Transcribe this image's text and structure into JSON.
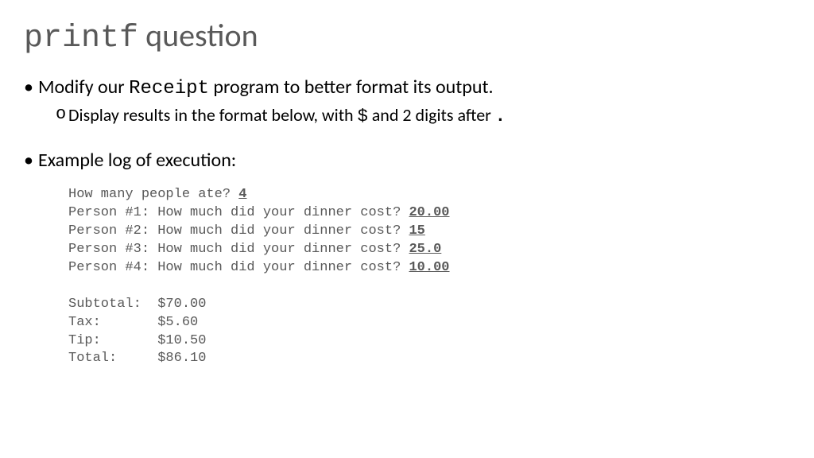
{
  "title": {
    "code": "printf",
    "rest": " question"
  },
  "bullet1": {
    "pre": "Modify our ",
    "code": "Receipt",
    "post": " program to better format its output."
  },
  "sub1": {
    "pre": "Display results in the format below, with ",
    "code1": "$",
    "mid": " and 2 digits after ",
    "code2": "."
  },
  "bullet2": "Example log of execution:",
  "log": {
    "q0": "How many people ate? ",
    "a0": "4",
    "q1": "Person #1: How much did your dinner cost? ",
    "a1": "20.00",
    "q2": "Person #2: How much did your dinner cost? ",
    "a2": "15",
    "q3": "Person #3: How much did your dinner cost? ",
    "a3": "25.0",
    "q4": "Person #4: How much did your dinner cost? ",
    "a4": "10.00",
    "subtotal": "Subtotal:  $70.00",
    "tax": "Tax:       $5.60",
    "tip": "Tip:       $10.50",
    "total": "Total:     $86.10"
  }
}
